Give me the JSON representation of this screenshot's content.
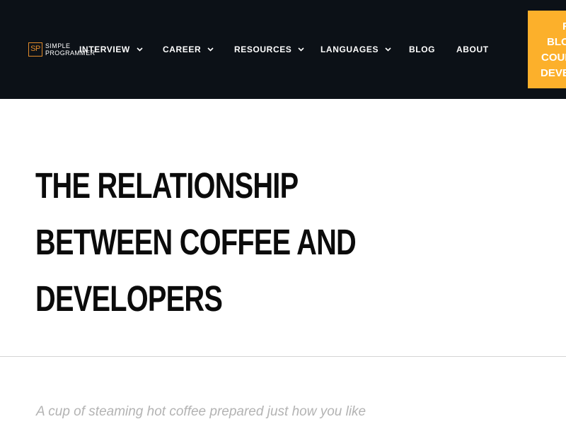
{
  "header": {
    "logo": {
      "mark": "SP",
      "line1": "SIMPLE",
      "line2": "PROGRAMMER"
    },
    "nav": [
      {
        "label": "INTERVIEW",
        "has_dropdown": true,
        "icon": "chevron-down-icon"
      },
      {
        "label": "CAREER",
        "has_dropdown": true,
        "icon": "chevron-down-icon"
      },
      {
        "label": "RESOURCES",
        "has_dropdown": true,
        "icon": "chevron-down-icon"
      },
      {
        "label": "LANGUAGES",
        "has_dropdown": true,
        "icon": "chevron-down-icon"
      },
      {
        "label": "BLOG",
        "has_dropdown": false
      },
      {
        "label": "ABOUT",
        "has_dropdown": false
      }
    ],
    "cta": {
      "line1": "F",
      "line2": "BLO",
      "line3": "COUI",
      "line4": "DEVE"
    }
  },
  "article": {
    "title_lines": [
      "THE RELATIONSHIP",
      "BETWEEN COFFEE AND",
      "DEVELOPERS"
    ],
    "image_caption": "A cup of steaming hot coffee prepared just how you like"
  },
  "colors": {
    "header_bg": "#0c1117",
    "accent": "#fcb02b",
    "logo_accent": "#e08a2a",
    "title_text": "#0b0b0b",
    "caption_text": "#b3b3b3",
    "divider": "#d4d4d4"
  }
}
